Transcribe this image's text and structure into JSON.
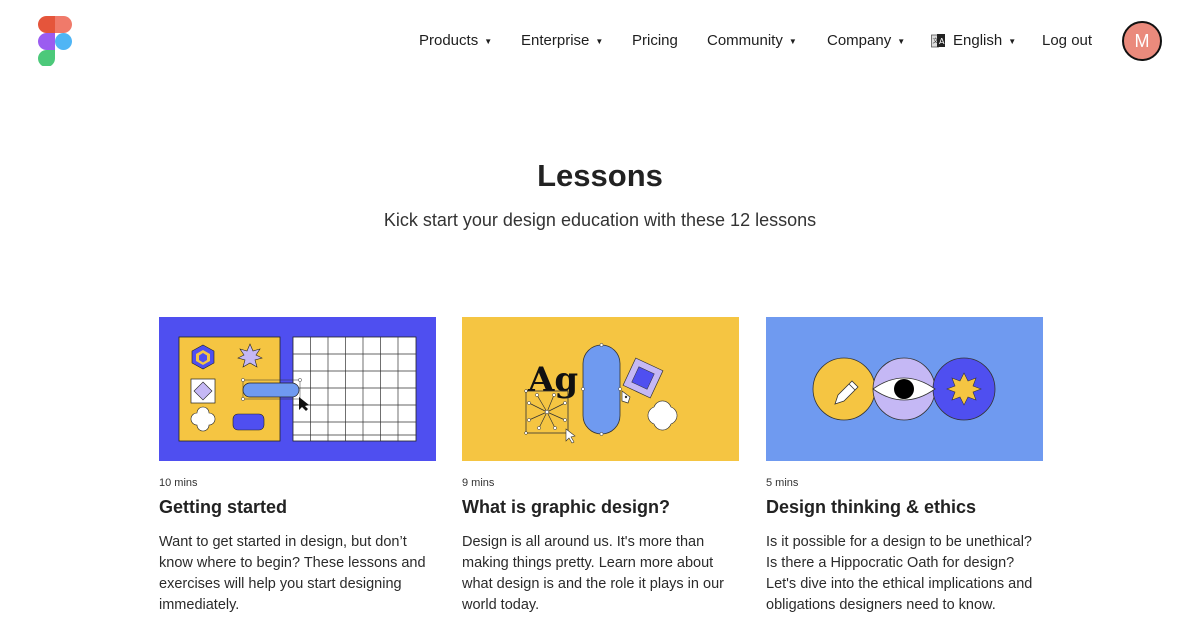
{
  "brand": {
    "logo_icon": "figma-logo-icon"
  },
  "nav": {
    "items": [
      {
        "label": "Products",
        "has_dropdown": true
      },
      {
        "label": "Enterprise",
        "has_dropdown": true
      },
      {
        "label": "Pricing",
        "has_dropdown": false
      },
      {
        "label": "Community",
        "has_dropdown": true
      },
      {
        "label": "Company",
        "has_dropdown": true
      }
    ],
    "language": {
      "label": "English",
      "icon": "translate-icon"
    },
    "logout_label": "Log out",
    "avatar_initial": "M",
    "caret": "▼"
  },
  "header": {
    "title": "Lessons",
    "subtitle": "Kick start your design education with these 12 lessons"
  },
  "lessons": [
    {
      "duration": "10 mins",
      "title": "Getting started",
      "description": "Want to get started in design, but don’t know where to begin? These lessons and exercises will help you start designing immediately.",
      "thumb_color": "#4f4ff0"
    },
    {
      "duration": "9 mins",
      "title": "What is graphic design?",
      "description": "Design is all around us. It's more than making things pretty. Learn more about what design is and the role it plays in our world today.",
      "thumb_color": "#f5c542",
      "thumb_text": "Ag"
    },
    {
      "duration": "5 mins",
      "title": "Design thinking & ethics",
      "description": "Is it possible for a design to be unethical? Is there a Hippocratic Oath for design? Let's dive into the ethical implications and obligations designers need to know.",
      "thumb_color": "#6f9af0"
    }
  ],
  "colors": {
    "avatar": "#ea8a7c",
    "yellow": "#f5c542",
    "indigo": "#4f4ff0",
    "lavender": "#c5b8f5",
    "blue": "#6f9af0"
  }
}
